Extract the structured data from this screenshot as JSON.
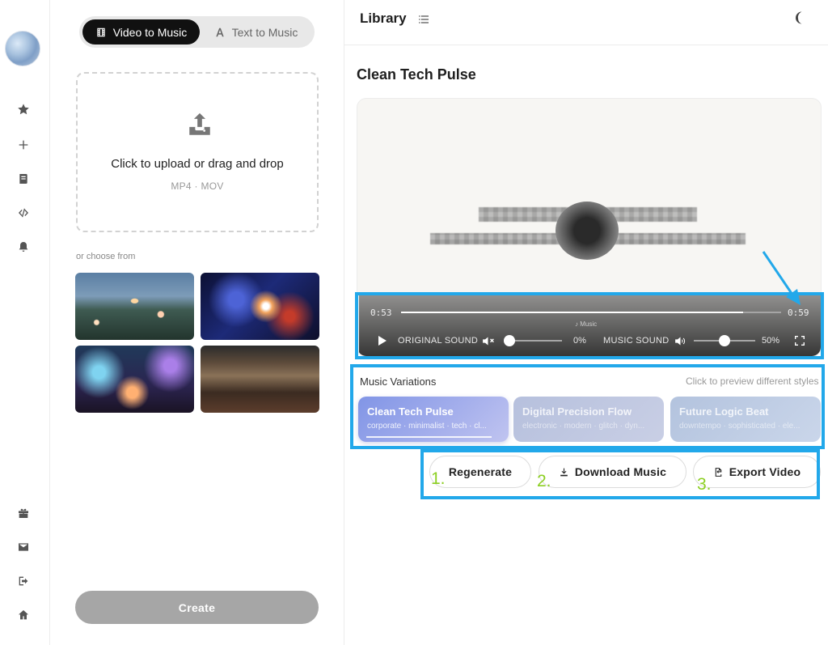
{
  "mode_toggle": {
    "video_label": "Video to Music",
    "text_label": "Text to Music"
  },
  "upload": {
    "title": "Click to upload or drag and drop",
    "formats": "MP4 · MOV"
  },
  "choose_label": "or choose from",
  "create_label": "Create",
  "library": {
    "title": "Library"
  },
  "track": {
    "title": "Clean Tech Pulse"
  },
  "player": {
    "current_time": "0:53",
    "total_time": "0:59",
    "progress": 0.9,
    "music_caption": "♪ Music",
    "original_sound_label": "ORIGINAL SOUND",
    "original_volume": "0%",
    "original_volume_value": 0,
    "music_sound_label": "MUSIC SOUND",
    "music_volume": "50%",
    "music_volume_value": 0.5
  },
  "variations": {
    "title": "Music Variations",
    "hint": "Click to preview different styles",
    "items": [
      {
        "name": "Clean Tech Pulse",
        "tags": "corporate · minimalist · tech · cl..."
      },
      {
        "name": "Digital Precision Flow",
        "tags": "electronic · modern · glitch · dyn..."
      },
      {
        "name": "Future Logic Beat",
        "tags": "downtempo · sophisticated · ele..."
      }
    ]
  },
  "actions": {
    "regenerate": "Regenerate",
    "download": "Download Music",
    "export": "Export Video"
  },
  "annotations": {
    "n1": "1.",
    "n2": "2.",
    "n3": "3."
  },
  "colors": {
    "highlight": "#22a8ea",
    "annotation_numbers": "#8ccf22"
  },
  "icons": [
    "star-icon",
    "plus-icon",
    "book-icon",
    "code-icon",
    "bell-icon",
    "gift-icon",
    "mail-icon",
    "logout-icon",
    "home-icon",
    "film-icon",
    "text-icon",
    "upload-icon",
    "list-icon",
    "moon-icon",
    "play-icon",
    "mute-icon",
    "volume-icon",
    "fullscreen-icon",
    "download-icon",
    "file-export-icon"
  ]
}
